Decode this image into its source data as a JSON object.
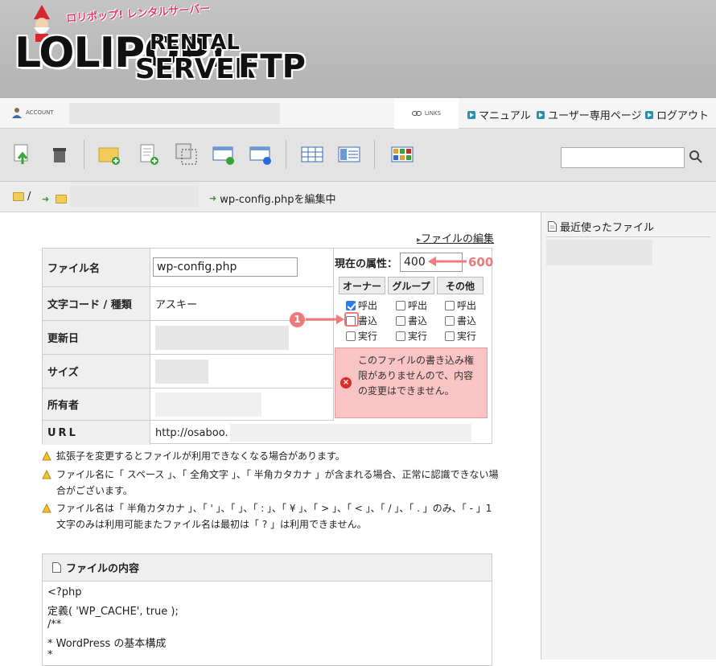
{
  "header": {
    "logo_main": "LOLIPOP!",
    "logo_rental": "RENTAL",
    "logo_server": "SERVER",
    "logo_ftp": "FTP",
    "logo_tagline": "ロリポップ! レンタルサーバー"
  },
  "account_bar": {
    "account_label": "ACCOUNT",
    "links_label": "LINKS",
    "nav": [
      {
        "label": "マニュアル"
      },
      {
        "label": "ユーザー専用ページ"
      },
      {
        "label": "ログアウト"
      }
    ]
  },
  "toolbar": {
    "icons": [
      "upload-icon",
      "trash-icon",
      "new-folder-icon",
      "new-file-icon",
      "copy-icon",
      "move-icon",
      "web-icon",
      "list-view-icon",
      "detail-view-icon",
      "thumbnail-view-icon"
    ],
    "search_placeholder": ""
  },
  "breadcrumb": {
    "root": "/",
    "current": "wp-config.phpを編集中"
  },
  "edit_link": "ファイルの編集",
  "file_info": {
    "rows": [
      {
        "label": "ファイル名",
        "value": "wp-config.php"
      },
      {
        "label": "文字コード / 種類",
        "value": "アスキー"
      },
      {
        "label": "更新日",
        "value": ""
      },
      {
        "label": "サイズ",
        "value": ""
      },
      {
        "label": "所有者",
        "value": ""
      },
      {
        "label": "URL",
        "value": "http://osaboo."
      }
    ]
  },
  "permissions": {
    "label": "現在の属性：",
    "value": "400",
    "groups": [
      {
        "label": "オーナー",
        "read": true,
        "write": false,
        "exec": false
      },
      {
        "label": "グループ",
        "read": false,
        "write": false,
        "exec": false
      },
      {
        "label": "その他",
        "read": false,
        "write": false,
        "exec": false
      }
    ],
    "read_label": "呼出",
    "write_label": "書込",
    "exec_label": "実行",
    "warning": "このファイルの書き込み権限がありませんので、内容の変更はできません。"
  },
  "annotations": {
    "target_value": "600",
    "step_number": "1",
    "accent_color": "#f07a7a"
  },
  "notes": [
    "拡張子を変更するとファイルが利用できなくなる場合があります。",
    "ファイル名に「 スペース 」、「 全角文字 」、「 半角カタカナ 」が含まれる場合、正常に認識できない場合がございます。",
    "ファイル名は「 半角カタカナ 」、「 ' 」、「 」、「 : 」、「 ¥ 」、「 > 」、「 < 」、「 / 」、「 . 」のみ、「 - 」1文字のみは利用可能またファイル名は最初は「 ? 」は利用できません。"
  ],
  "file_content": {
    "title": "ファイルの内容",
    "lines": [
      "<?php",
      "定義( 'WP_CACHE', true );",
      "/**",
      " * WordPress の基本構成",
      " *"
    ]
  },
  "sidebar": {
    "recent_title": "最近使ったファイル"
  }
}
